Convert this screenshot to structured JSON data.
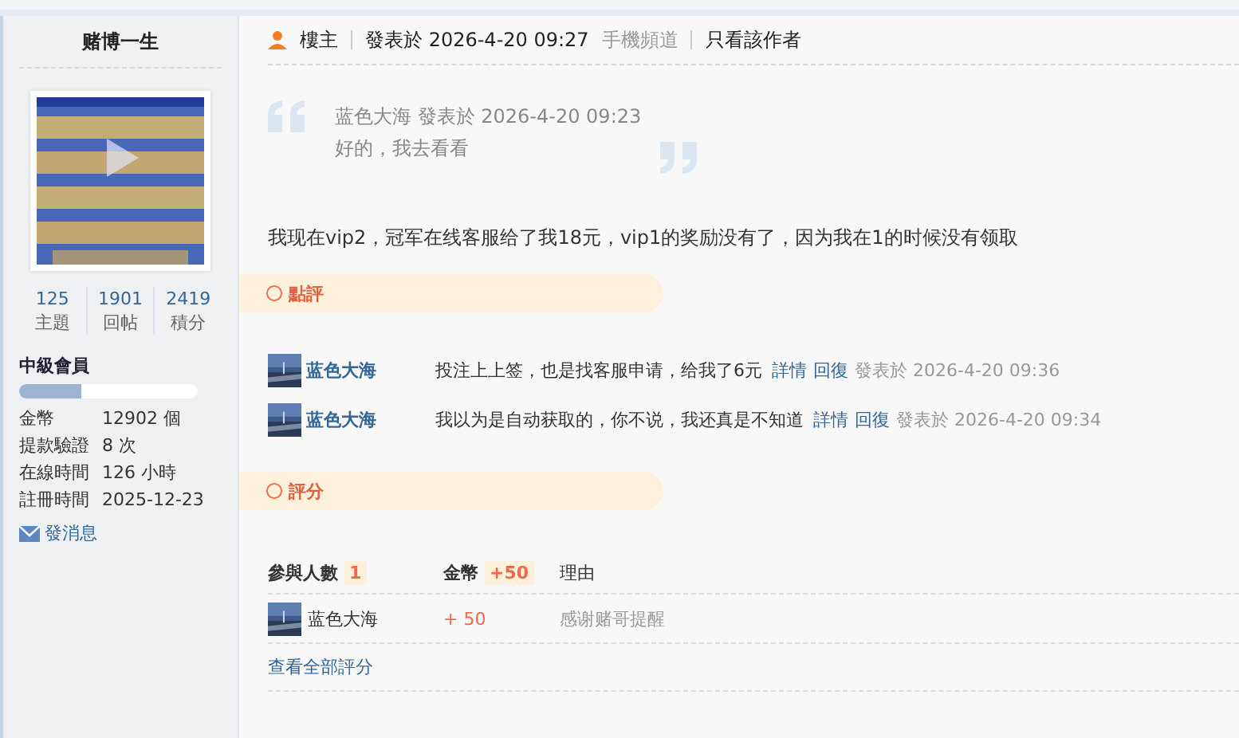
{
  "sidebar": {
    "username": "赌博一生",
    "stats": [
      {
        "value": "125",
        "label": "主題"
      },
      {
        "value": "1901",
        "label": "回帖"
      },
      {
        "value": "2419",
        "label": "積分"
      }
    ],
    "rank": "中級會員",
    "rank_progress": {
      "level": 0.35
    },
    "info": [
      {
        "label": "金幣",
        "value": "12902 個"
      },
      {
        "label": "提款驗證",
        "value": "8 次"
      },
      {
        "label": "在線時間",
        "value": "126 小時"
      },
      {
        "label": "註冊時間",
        "value": "2025-12-23"
      }
    ],
    "message_link": "發消息"
  },
  "post": {
    "author_badge": "樓主",
    "posted": "發表於 2026-4-20 09:27",
    "source": "手機頻道",
    "only_author": "只看該作者",
    "quote": {
      "header": "蓝色大海 發表於 2026-4-20 09:23",
      "text": "好的，我去看看"
    },
    "body": "我现在vip2，冠军在线客服给了我18元，vip1的奖励没有了，因为我在1的时候没有领取"
  },
  "comments": {
    "title": "點評",
    "items": [
      {
        "user": "蓝色大海",
        "text": "投注上上签，也是找客服申请，给我了6元",
        "detail": "詳情",
        "reply": "回復",
        "time": "發表於 2026-4-20 09:36"
      },
      {
        "user": "蓝色大海",
        "text": "我以为是自动获取的，你不说，我还真是不知道",
        "detail": "詳情",
        "reply": "回復",
        "time": "發表於 2026-4-20 09:34"
      }
    ]
  },
  "rating": {
    "title": "評分",
    "participants_label": "參與人數",
    "participants": "1",
    "coins_label": "金幣",
    "coins_total": "+50",
    "reason_label": "理由",
    "rows": [
      {
        "user": "蓝色大海",
        "coins": "+ 50",
        "reason": "感谢赌哥提醒"
      }
    ],
    "view_all": "查看全部評分"
  }
}
